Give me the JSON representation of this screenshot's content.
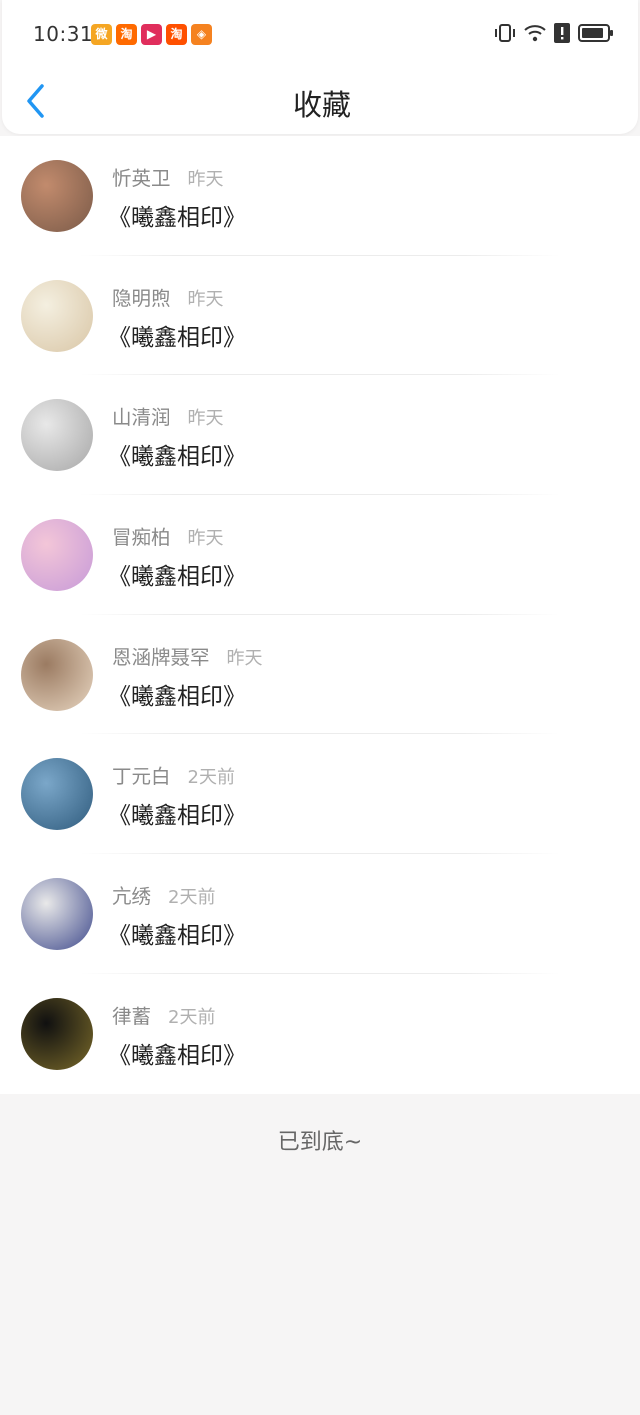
{
  "status_bar": {
    "time": "10:31",
    "app_icons": [
      {
        "name": "weibo-icon",
        "glyph": "微",
        "color": "#f5a623"
      },
      {
        "name": "taobao-special-icon",
        "glyph": "淘",
        "color": "#ff6a00"
      },
      {
        "name": "video-app-icon",
        "glyph": "▶",
        "color": "#e02e5c"
      },
      {
        "name": "taobao-icon",
        "glyph": "淘",
        "color": "#ff5000"
      },
      {
        "name": "shop-app-icon",
        "glyph": "◈",
        "color": "#f58220"
      }
    ]
  },
  "header": {
    "title": "收藏",
    "accent_color": "#2196f3"
  },
  "favorites": [
    {
      "user": "忻英卫",
      "time": "昨天",
      "title": "《曦鑫相印》",
      "avatar_colors": [
        "#c28b6d",
        "#7a5a48"
      ]
    },
    {
      "user": "隐明煦",
      "time": "昨天",
      "title": "《曦鑫相印》",
      "avatar_colors": [
        "#f4efe0",
        "#d9c6a6"
      ]
    },
    {
      "user": "山清润",
      "time": "昨天",
      "title": "《曦鑫相印》",
      "avatar_colors": [
        "#e8e8e8",
        "#a7a7a7"
      ]
    },
    {
      "user": "冒痴柏",
      "time": "昨天",
      "title": "《曦鑫相印》",
      "avatar_colors": [
        "#f3c6d8",
        "#c79ad8"
      ]
    },
    {
      "user": "恩涵牌聂罕",
      "time": "昨天",
      "title": "《曦鑫相印》",
      "avatar_colors": [
        "#9b7b62",
        "#e7d5c0"
      ]
    },
    {
      "user": "丁元白",
      "time": "2天前",
      "title": "《曦鑫相印》",
      "avatar_colors": [
        "#7ba7c9",
        "#2f5b7d"
      ]
    },
    {
      "user": "亢绣",
      "time": "2天前",
      "title": "《曦鑫相印》",
      "avatar_colors": [
        "#e9e9e9",
        "#3f4a8c"
      ]
    },
    {
      "user": "律蓄",
      "time": "2天前",
      "title": "《曦鑫相印》",
      "avatar_colors": [
        "#101010",
        "#7a6a2a"
      ]
    }
  ],
  "footer": {
    "end_text": "已到底~"
  }
}
